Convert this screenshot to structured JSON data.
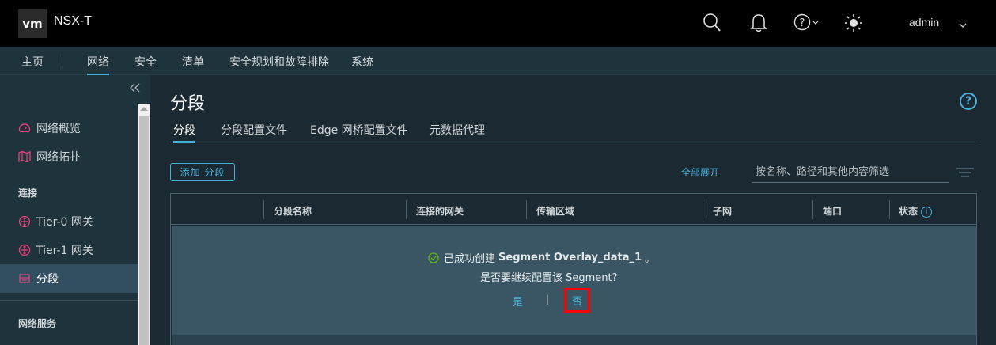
{
  "header": {
    "logo_text": "vm",
    "app_name": "NSX-T",
    "user": "admin",
    "icons": [
      "search-icon",
      "bell-icon",
      "help-icon",
      "theme-sun-icon"
    ]
  },
  "nav": {
    "items": [
      "主页",
      "网络",
      "安全",
      "清单",
      "安全规划和故障排除",
      "系统"
    ],
    "active": "网络"
  },
  "sidebar": {
    "items": [
      {
        "label": "网络概览",
        "icon": "dashboard-icon"
      },
      {
        "label": "网络拓扑",
        "icon": "map-icon"
      }
    ],
    "section_connect": "连接",
    "connect_items": [
      {
        "label": "Tier-0 网关",
        "icon": "gateway-icon"
      },
      {
        "label": "Tier-1 网关",
        "icon": "gateway-icon"
      },
      {
        "label": "分段",
        "icon": "segment-icon"
      }
    ],
    "section_services": "网络服务"
  },
  "main": {
    "title": "分段",
    "tabs": [
      "分段",
      "分段配置文件",
      "Edge 网桥配置文件",
      "元数据代理"
    ],
    "add_button": "添加 分段",
    "expand_all": "全部展开",
    "filter_placeholder": "按名称、路径和其他内容筛选"
  },
  "table": {
    "columns": [
      "分段名称",
      "连接的网关",
      "传输区域",
      "子网",
      "端口",
      "状态"
    ]
  },
  "banner": {
    "msg_prefix": "已成功创建",
    "segment_name": "Segment Overlay_data_1",
    "msg_suffix": "。",
    "question": "是否要继续配置该 Segment?",
    "yes": "是",
    "separator": "|",
    "no": "否"
  },
  "colors": {
    "accent": "#49afd9",
    "highlight": "#ff0000",
    "success": "#5eb715"
  }
}
